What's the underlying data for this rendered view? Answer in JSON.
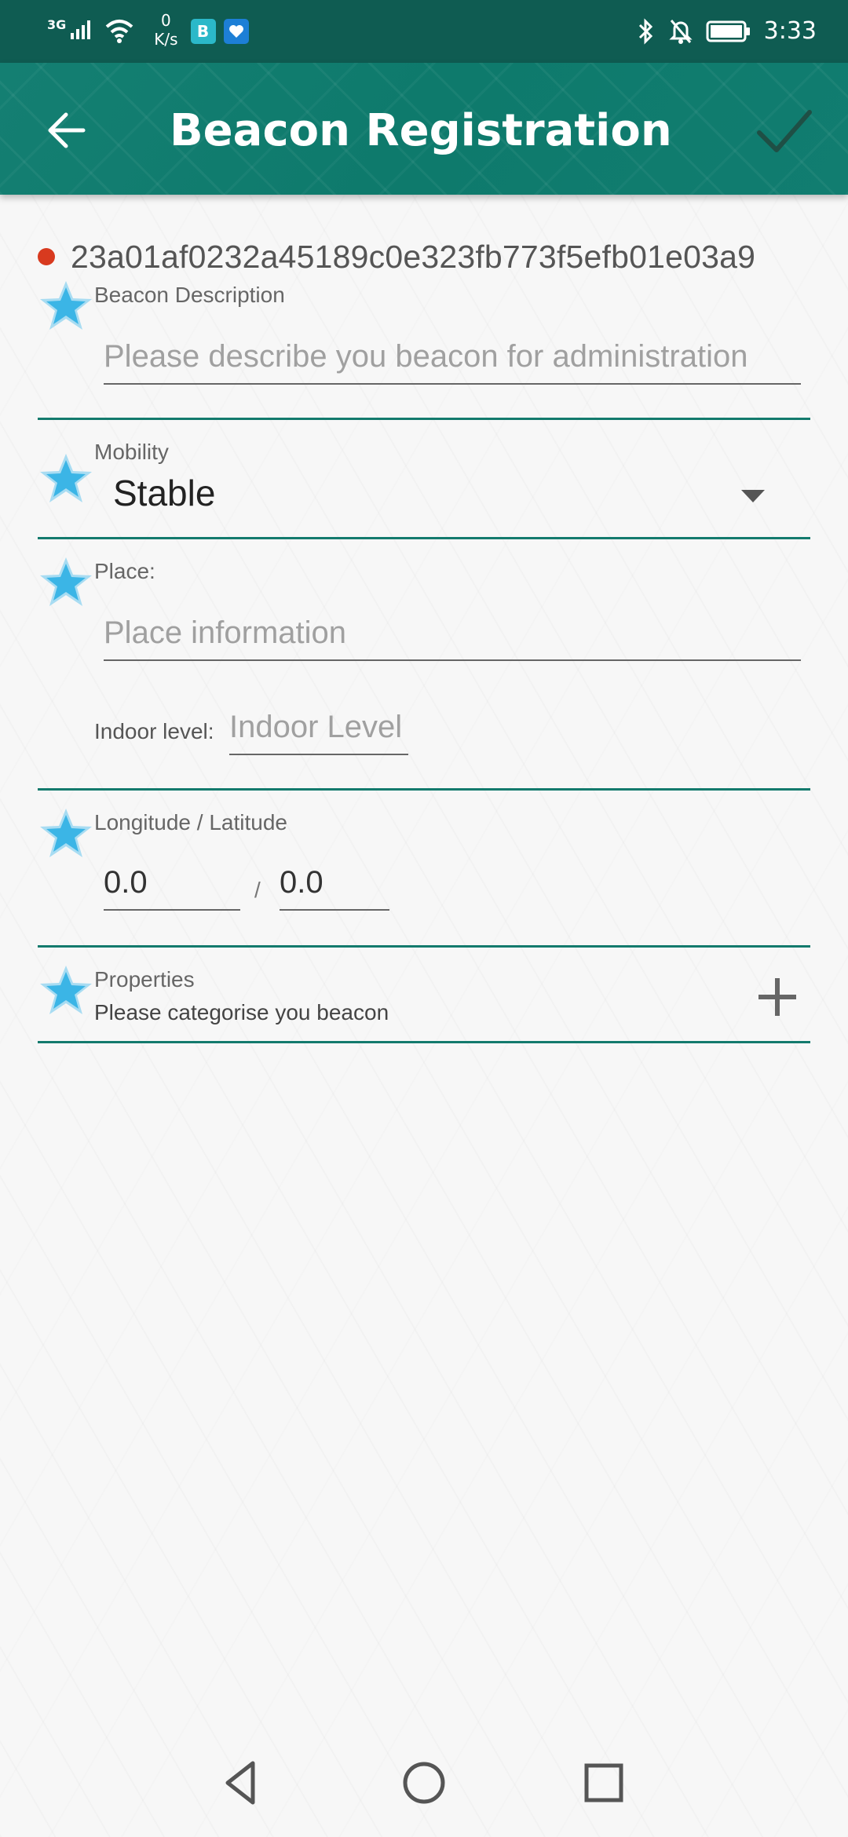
{
  "status_bar": {
    "network": "3G",
    "speed_value": "0",
    "speed_unit": "K/s",
    "app_badge_1": "B",
    "time": "3:33"
  },
  "app_bar": {
    "title": "Beacon Registration",
    "back_icon": "arrow-back-icon",
    "confirm_icon": "check-icon"
  },
  "beacon": {
    "id": "23a01af0232a45189c0e323fb773f5efb01e03a9"
  },
  "form": {
    "description": {
      "label": "Beacon Description",
      "placeholder": "Please describe you beacon for administration"
    },
    "mobility": {
      "label": "Mobility",
      "value": "Stable"
    },
    "place": {
      "label": "Place:",
      "placeholder": "Place information",
      "indoor_label": "Indoor level:",
      "indoor_placeholder": "Indoor Level"
    },
    "coordinates": {
      "label": "Longitude / Latitude",
      "longitude": "0.0",
      "separator": "/",
      "latitude": "0.0"
    },
    "properties": {
      "label": "Properties",
      "hint": "Please categorise you beacon"
    }
  },
  "colors": {
    "primary": "#117d70",
    "status_bar": "#0f5c52",
    "divider": "#137a6d",
    "star": "#3bb5e6"
  }
}
